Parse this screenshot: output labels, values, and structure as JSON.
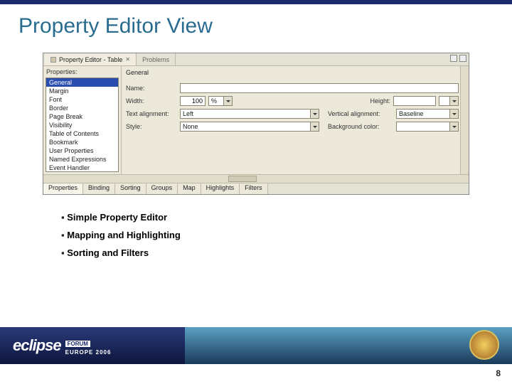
{
  "slide": {
    "title": "Property Editor View",
    "page_number": "8"
  },
  "bullets": [
    "Simple Property Editor",
    "Mapping and Highlighting",
    "Sorting and Filters"
  ],
  "editor": {
    "top_tabs": {
      "active": "Property Editor - Table",
      "inactive": "Problems"
    },
    "left_header": "Properties:",
    "property_list": [
      "General",
      "Margin",
      "Font",
      "Border",
      "Page Break",
      "Visibility",
      "Table of Contents",
      "Bookmark",
      "User Properties",
      "Named Expressions",
      "Event Handler"
    ],
    "selected_property": "General",
    "right_header": "General",
    "fields": {
      "name_label": "Name:",
      "name_value": "",
      "width_label": "Width:",
      "width_value": "100",
      "width_unit": "%",
      "height_label": "Height:",
      "height_value": "",
      "text_align_label": "Text alignment:",
      "text_align_value": "Left",
      "vert_align_label": "Vertical alignment:",
      "vert_align_value": "Baseline",
      "style_label": "Style:",
      "style_value": "None",
      "bg_label": "Background color:",
      "bg_value": ""
    },
    "bottom_tabs": [
      "Properties",
      "Binding",
      "Sorting",
      "Groups",
      "Map",
      "Highlights",
      "Filters"
    ],
    "bottom_selected": "Properties"
  },
  "footer": {
    "logo": "eclipse",
    "badge_forum": "FORUM",
    "badge_europe": "EUROPE 2006"
  }
}
